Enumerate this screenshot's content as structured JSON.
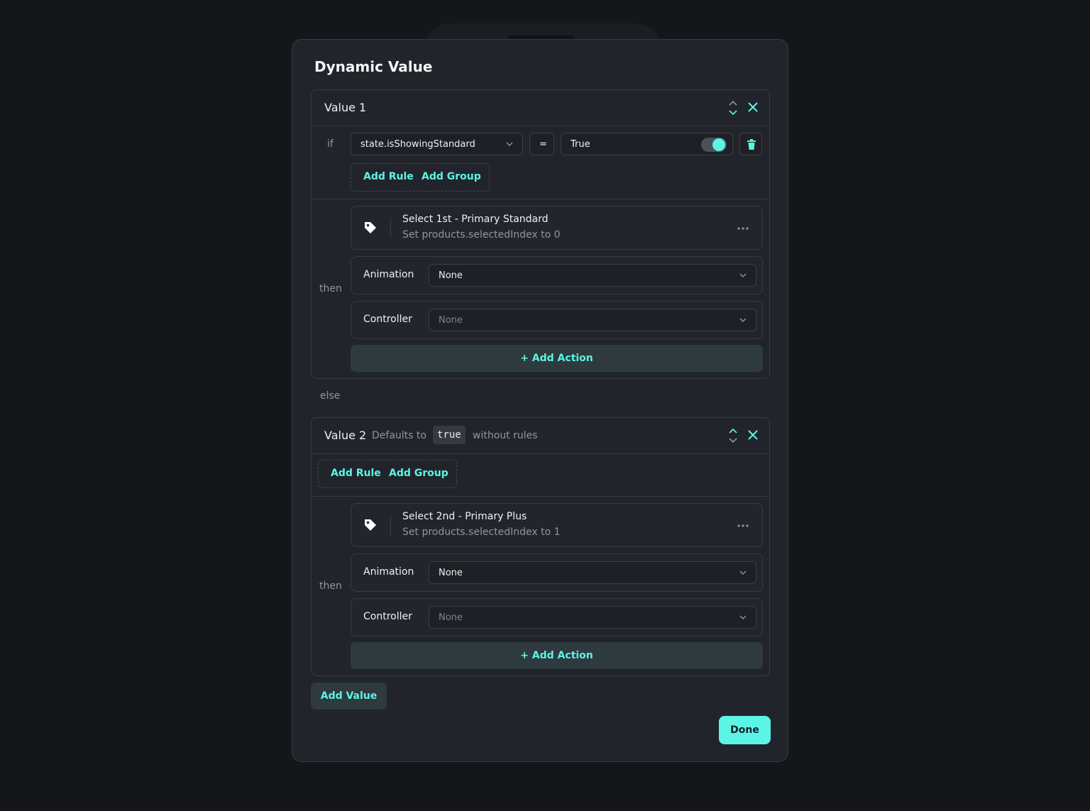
{
  "modal": {
    "title": "Dynamic Value",
    "else_label": "else",
    "add_value_label": "Add Value",
    "done_label": "Done"
  },
  "value1": {
    "title": "Value 1",
    "if_label": "if",
    "condition": {
      "variable": "state.isShowingStandard",
      "operator": "=",
      "value": "True",
      "toggle_on": true
    },
    "add_rule_label": "Add Rule",
    "add_group_label": "Add Group",
    "then_label": "then",
    "action": {
      "title": "Select 1st - Primary Standard",
      "description": "Set products.selectedIndex to 0"
    },
    "animation": {
      "label": "Animation",
      "value": "None"
    },
    "controller": {
      "label": "Controller",
      "placeholder": "None"
    },
    "add_action_label": "+ Add Action"
  },
  "value2": {
    "title": "Value 2",
    "defaults_prefix": "Defaults to",
    "defaults_code": "true",
    "defaults_suffix": "without rules",
    "add_rule_label": "Add Rule",
    "add_group_label": "Add Group",
    "then_label": "then",
    "action": {
      "title": "Select 2nd - Primary Plus",
      "description": "Set products.selectedIndex to 1"
    },
    "animation": {
      "label": "Animation",
      "value": "None"
    },
    "controller": {
      "label": "Controller",
      "placeholder": "None"
    },
    "add_action_label": "+ Add Action"
  },
  "colors": {
    "accent": "#5cf4e4",
    "panel": "#21252b",
    "background": "#14161a"
  }
}
